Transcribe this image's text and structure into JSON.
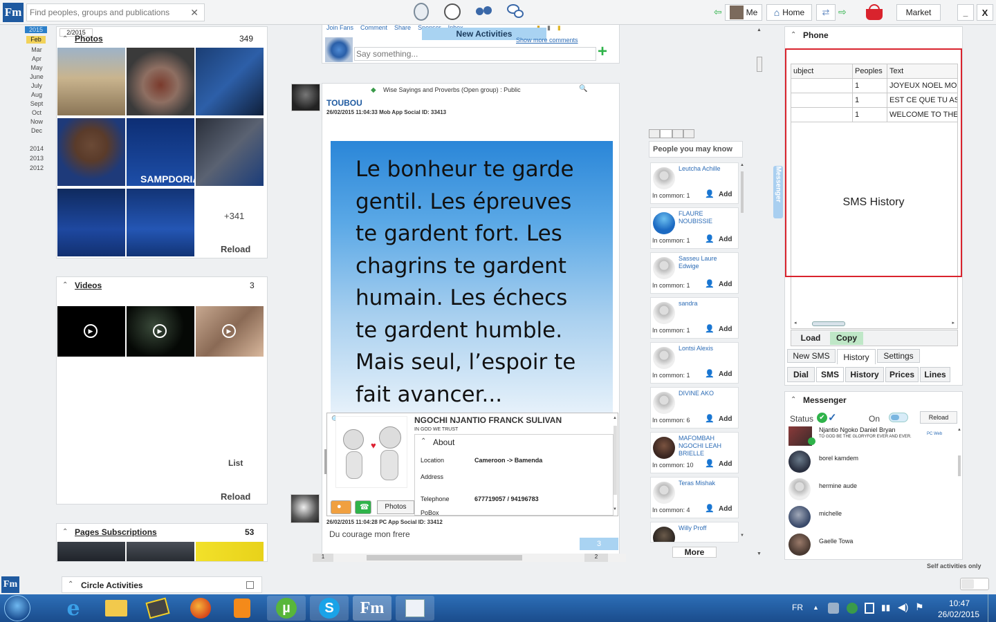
{
  "topbar": {
    "search_placeholder": "Find peoples, groups and publications",
    "me_label": "Me",
    "home_label": "Home",
    "market_label": "Market",
    "minimize": "_",
    "close": "X"
  },
  "calendar": {
    "current": "2015",
    "months": [
      "Feb",
      "Mar",
      "Apr",
      "May",
      "June",
      "July",
      "Aug",
      "Sept",
      "Oct",
      "Now",
      "Dec"
    ],
    "years": [
      "2014",
      "2013",
      "2012"
    ],
    "tooltip": "2/2015"
  },
  "photos": {
    "title": "Photos",
    "count": "349",
    "more": "+341",
    "reload": "Reload",
    "sampdoria": "SAMPDORIA"
  },
  "videos": {
    "title": "Videos",
    "count": "3",
    "list": "List",
    "reload": "Reload"
  },
  "pages": {
    "title": "Pages Subscriptions",
    "count": "53"
  },
  "circle": {
    "title": "Circle Activities"
  },
  "feed": {
    "actions": [
      "Join Fans",
      "Comment",
      "Share",
      "Sponsor",
      "Inbox"
    ],
    "new_activities": "New Activities",
    "show_more": "Show more comments",
    "say_placeholder": "Say something...",
    "post": {
      "group": "Wise Sayings and Proverbs (Open group) : Public",
      "author": "TOUBOU",
      "meta": "26/02/2015 11:04:33  Mob App  Social ID: 33413",
      "quote": "Le bonheur te garde gentil. Les épreuves te gardent fort. Les chagrins te gardent humain. Les échecs te gardent humble. Mais seul, l’espoir te fait avancer..."
    },
    "post2": {
      "meta": "26/02/2015 11:04:28  PC App  Social ID: 33412",
      "text": "Du courage mon frere",
      "count": "3"
    },
    "pager": [
      "1",
      "2"
    ]
  },
  "profile": {
    "name": "NGOCHI NJANTIO FRANCK SULIVAN",
    "motto": "IN GOD WE TRUST",
    "about": "About",
    "location_label": "Location",
    "location_value": "Cameroon -> Bamenda",
    "address_label": "Address",
    "telephone_label": "Telephone",
    "telephone_value": "677719057 / 94196783",
    "pobox_label": "PoBox",
    "photos_button": "Photos"
  },
  "people": {
    "title": "People you may know",
    "add": "Add",
    "more": "More",
    "list": [
      {
        "name": "Leutcha Achille",
        "common": "In common: 1"
      },
      {
        "name": "FLAURE NOUBISSIE",
        "common": "In common: 1"
      },
      {
        "name": "Sasseu Laure Edwige",
        "common": "In common: 1"
      },
      {
        "name": "sandra",
        "common": "In common: 1"
      },
      {
        "name": "Lontsi Alexis",
        "common": "In common: 1"
      },
      {
        "name": "DIVINE AKO",
        "common": "In common: 6"
      },
      {
        "name": "MAFOMBAH NGOCHI LEAH BRIELLE",
        "common": "In common: 10"
      },
      {
        "name": "Teras Mishak",
        "common": "In common: 4"
      },
      {
        "name": "Willy Proff",
        "common": ""
      }
    ]
  },
  "messenger_tab": "Messenger",
  "phone": {
    "title": "Phone",
    "columns": [
      "ubject",
      "Peoples",
      "Text"
    ],
    "rows": [
      [
        "",
        "1",
        "JOYEUX NOEL MO"
      ],
      [
        "",
        "1",
        "EST CE QUE TU AS"
      ],
      [
        "",
        "1",
        "WELCOME TO THE"
      ]
    ],
    "history_label": "SMS History",
    "load": "Load",
    "copy": "Copy",
    "sms_tabs": [
      "New SMS",
      "History",
      "Settings"
    ],
    "main_tabs": [
      "Dial",
      "SMS",
      "History",
      "Prices",
      "Lines"
    ]
  },
  "messenger": {
    "title": "Messenger",
    "status": "Status",
    "on": "On",
    "reload": "Reload",
    "self_only": "Self activities only",
    "contacts": [
      {
        "name": "Njantio Ngoko Daniel Bryan",
        "sub": "TO GOD BE THE GLORYFOR EVER AND EVER.",
        "tag": "PC Web"
      },
      {
        "name": "borel kamdem",
        "sub": "",
        "tag": ""
      },
      {
        "name": "hermine aude",
        "sub": "",
        "tag": ""
      },
      {
        "name": "michelle",
        "sub": "",
        "tag": ""
      },
      {
        "name": "Gaelle Towa",
        "sub": "",
        "tag": ""
      }
    ]
  },
  "taskbar": {
    "lang": "FR",
    "time": "10:47",
    "date": "26/02/2015"
  },
  "colors": {
    "accent": "#2b6bb5",
    "highlight": "#d9232d",
    "taskbar": "#1f5aa0",
    "green": "#2fb34a"
  }
}
